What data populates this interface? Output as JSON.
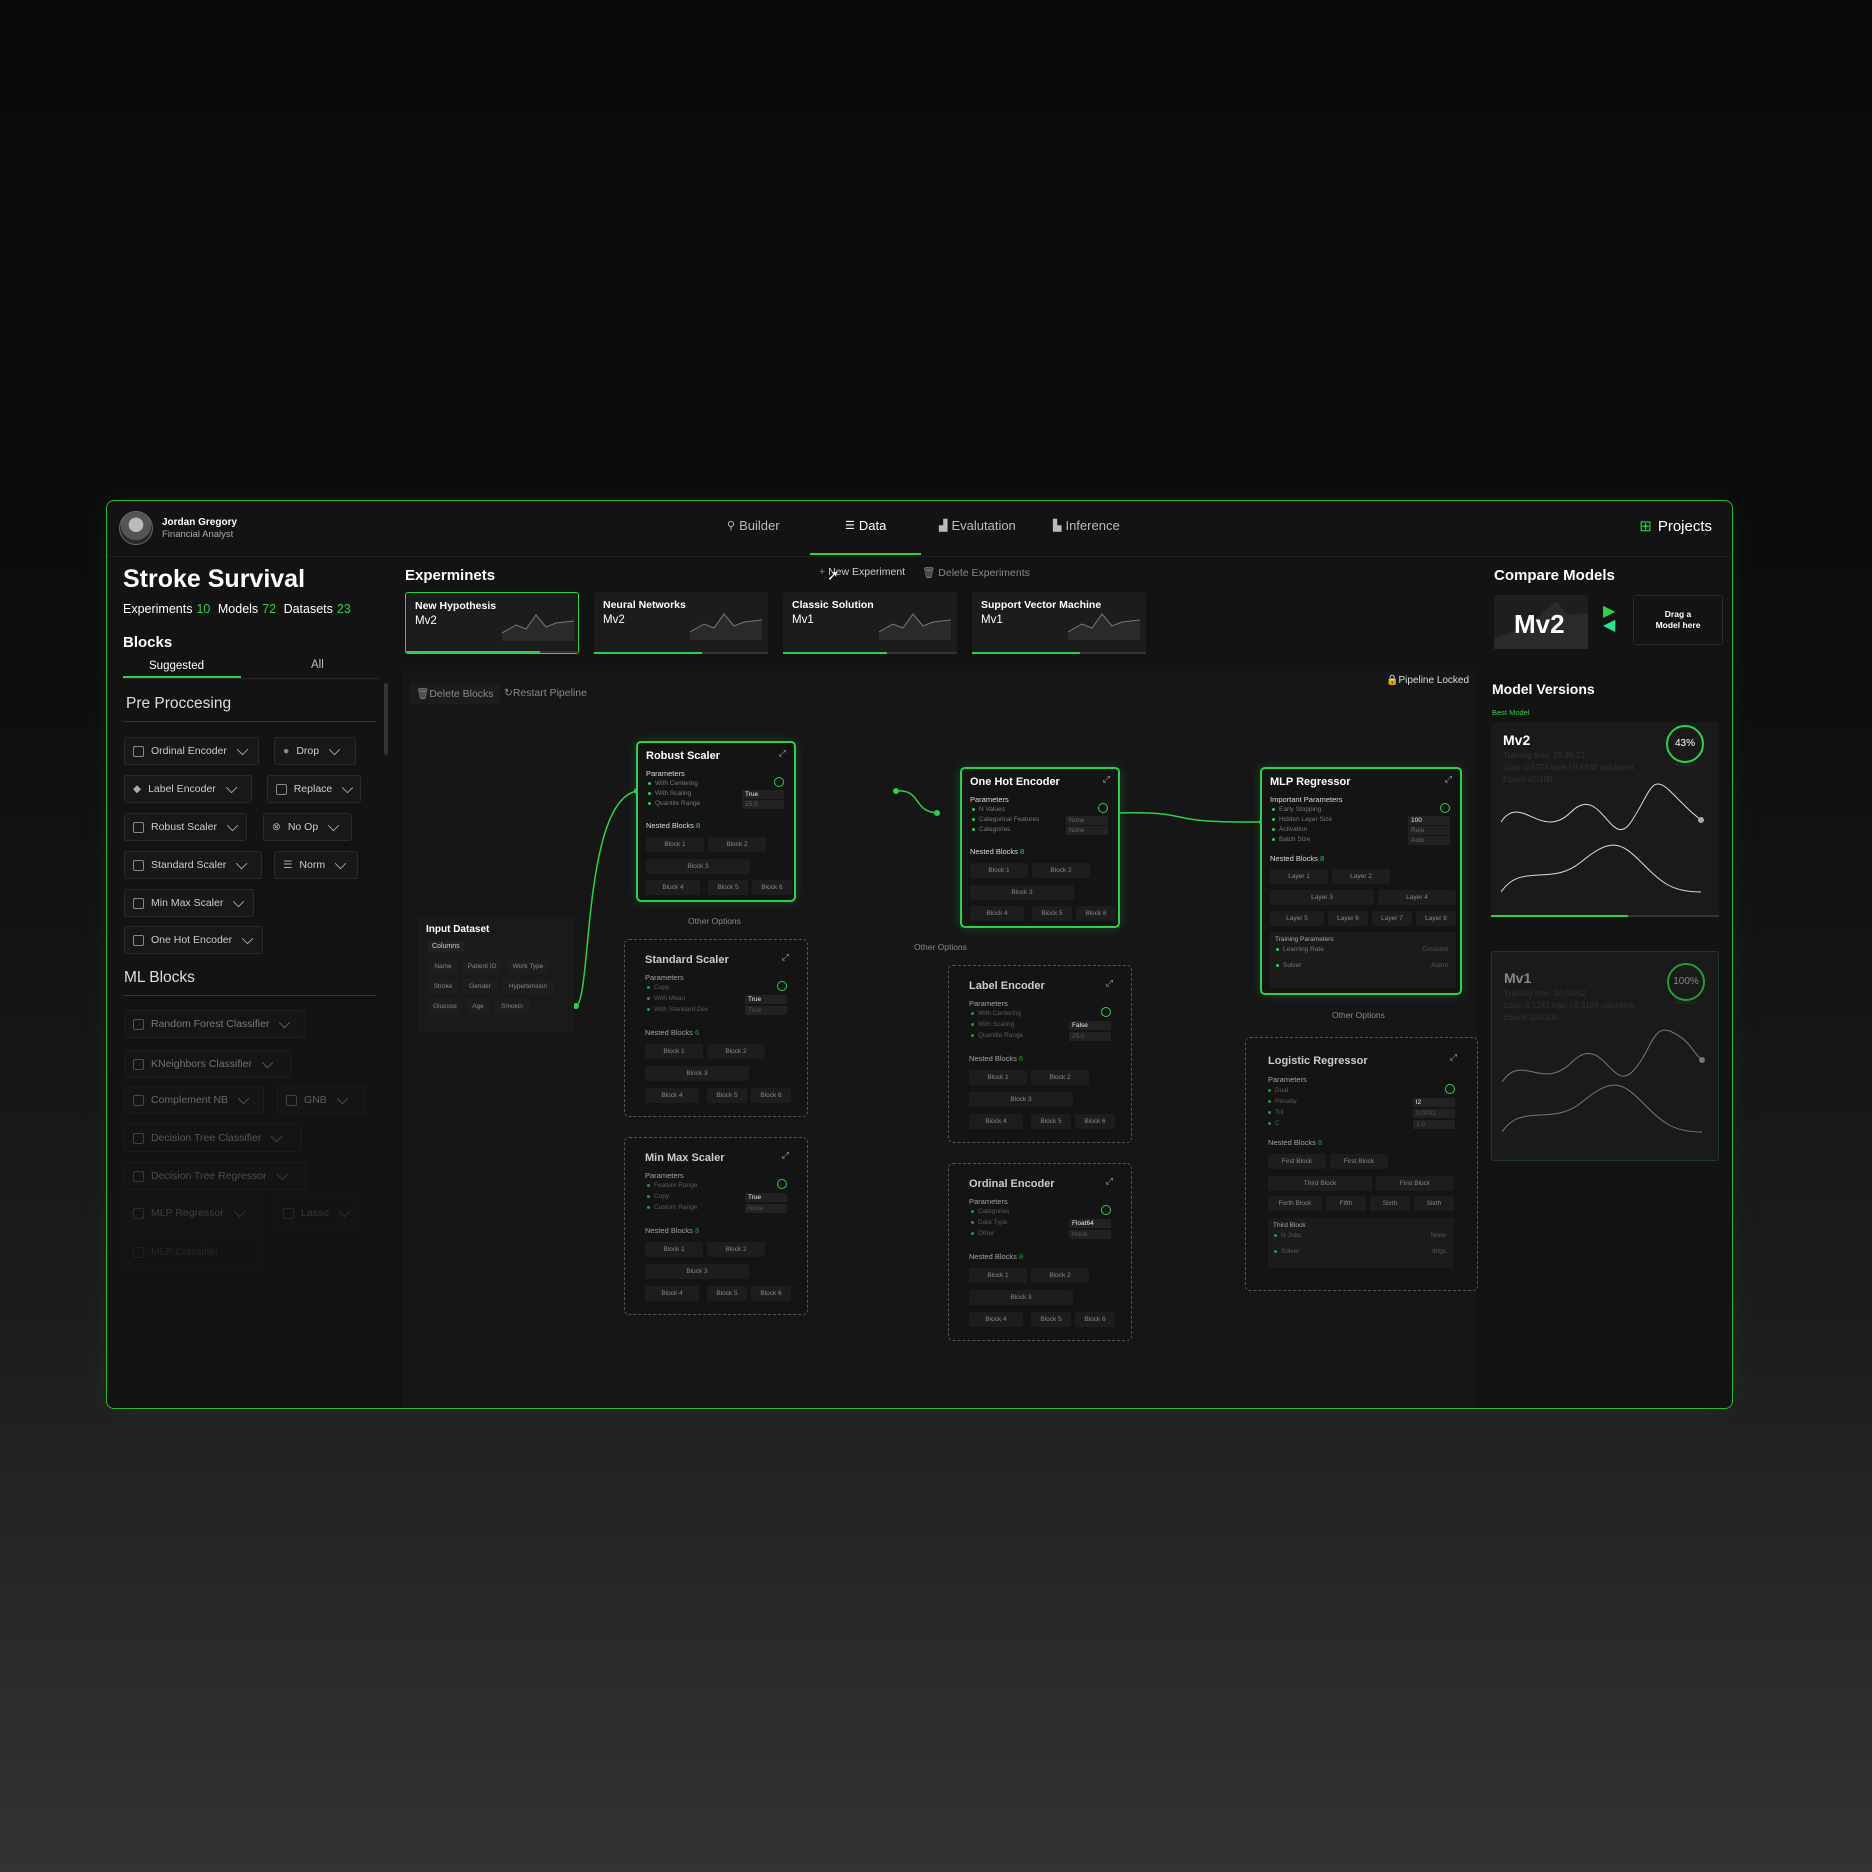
{
  "header": {
    "user_name": "Jordan Gregory",
    "user_role": "Financial Analyst",
    "nav": [
      "Builder",
      "Data",
      "Evalutation",
      "Inference"
    ],
    "active_nav": "Data",
    "projects_label": "Projects"
  },
  "project": {
    "title": "Stroke Survival",
    "experiments_label": "Experiments",
    "experiments_count": "10",
    "models_label": "Models",
    "models_count": "72",
    "datasets_label": "Datasets",
    "datasets_count": "23"
  },
  "blocks": {
    "heading": "Blocks",
    "tabs": [
      "Suggested",
      "All"
    ],
    "active_tab": "Suggested",
    "preprocessing_title": "Pre Proccesing",
    "preprocessing": [
      "Ordinal Encoder",
      "Drop",
      "Label Encoder",
      "Replace",
      "Robust Scaler",
      "No Op",
      "Standard Scaler",
      "Norm",
      "Min Max Scaler",
      "One Hot Encoder"
    ],
    "ml_title": "ML Blocks",
    "ml": [
      "Random Forest Classifier",
      "KNeighbors Classifier",
      "Complement NB",
      "GNB",
      "Decision Tree Classifier",
      "Decision Tree Regressor",
      "MLP Regressor",
      "Lasso",
      "MLP Classifier"
    ]
  },
  "experiments": {
    "heading": "Experminets",
    "new_label": "New Experiment",
    "delete_label": "Delete Experiments",
    "cards": [
      {
        "name": "New Hypothesis",
        "version": "Mv2",
        "progress": 0.78,
        "selected": true
      },
      {
        "name": "Neural Networks",
        "version": "Mv2",
        "progress": 0.62,
        "selected": false
      },
      {
        "name": "Classic Solution",
        "version": "Mv1",
        "progress": 0.6,
        "selected": false
      },
      {
        "name": "Support Vector Machine",
        "version": "Mv1",
        "progress": 0.62,
        "selected": false
      }
    ]
  },
  "pipeline": {
    "delete_blocks": "Delete Blocks",
    "restart": "Restart Pipeline",
    "locked": "Pipeline Locked",
    "other_options": "Other Options",
    "parameters": "Parameters",
    "important_parameters": "Important Parameters",
    "nested_blocks": "Nested Blocks",
    "input": {
      "title": "Input Dataset",
      "columns_label": "Columns",
      "columns": [
        "Name",
        "Patient ID",
        "Work Type",
        "Stroke",
        "Gender",
        "Hypertension",
        "Glucose",
        "Age",
        "Smokin"
      ]
    },
    "robust": {
      "title": "Robust Scaler",
      "params": [
        "With Centering",
        "With Scaling",
        "Quantile Range"
      ],
      "values": [
        "",
        "True",
        "25.0"
      ],
      "nested": "8",
      "blocks": [
        "Block 1",
        "Block 2",
        "Block 3",
        "Block 4",
        "Block 5",
        "Block 6"
      ]
    },
    "onehot": {
      "title": "One Hot Encoder",
      "params": [
        "N Values",
        "Categorical Features",
        "Categories"
      ],
      "values": [
        "",
        "None",
        "None"
      ],
      "nested": "8",
      "blocks": [
        "Block 1",
        "Block 2",
        "Block 3",
        "Block 4",
        "Block 5",
        "Block 6"
      ]
    },
    "mlp": {
      "title": "MLP Regressor",
      "params": [
        "Early Stopping",
        "Hidden Layer Size",
        "Activation",
        "Batch Size"
      ],
      "values": [
        "",
        "100",
        "Relu",
        "Auto"
      ],
      "nested": "8",
      "layers": [
        "Layer 1",
        "Layer 2",
        "Layer 3",
        "Layer 4",
        "Layer 5",
        "Layer 6",
        "Layer 7",
        "Layer 8"
      ],
      "training_label": "Training Parameters",
      "training": [
        "Learning Rate",
        "Solver"
      ],
      "training_values": [
        "Constant",
        "Adam"
      ]
    },
    "standard": {
      "title": "Standard Scaler",
      "params": [
        "Copy",
        "With Mean",
        "With Standard Dev"
      ],
      "values": [
        "",
        "True",
        "True"
      ],
      "nested": "6",
      "blocks": [
        "Block 1",
        "Block 2",
        "Block 3",
        "Block 4",
        "Block 5",
        "Block 6"
      ]
    },
    "label": {
      "title": "Label Encoder",
      "params": [
        "With Centering",
        "With Scaling",
        "Quantile Range"
      ],
      "values": [
        "",
        "False",
        "25.0"
      ],
      "nested": "6",
      "blocks": [
        "Block 1",
        "Block 2",
        "Block 3",
        "Block 4",
        "Block 5",
        "Block 6"
      ]
    },
    "minmax": {
      "title": "Min Max Scaler",
      "params": [
        "Feature Range",
        "Copy",
        "Custom Range"
      ],
      "values": [
        "",
        "True",
        "None"
      ],
      "nested": "8",
      "blocks": [
        "Block 1",
        "Block 2",
        "Block 3",
        "Block 4",
        "Block 5",
        "Block 6"
      ]
    },
    "ordinal": {
      "title": "Ordinal Encoder",
      "params": [
        "Categories",
        "Data Type",
        "Other"
      ],
      "values": [
        "",
        "Float64",
        "None"
      ],
      "nested": "8",
      "blocks": [
        "Block 1",
        "Block 2",
        "Block 3",
        "Block 4",
        "Block 5",
        "Block 6"
      ]
    },
    "logistic": {
      "title": "Logistic Regressor",
      "params": [
        "Dual",
        "Penalty",
        "Tol",
        "C"
      ],
      "values": [
        "",
        "l2",
        "0.0001",
        "1.0"
      ],
      "nested": "8",
      "blocks": [
        "First Block",
        "First Block",
        "Third Block",
        "First Block",
        "Forth Block",
        "Fifth",
        "Sixth",
        "Sixth"
      ],
      "sub_label": "Third Block",
      "sub": [
        "N Jobs",
        "Solver"
      ],
      "sub_values": [
        "None",
        "lbfgs"
      ]
    }
  },
  "compare": {
    "heading": "Compare Models",
    "model": "Mv2",
    "drop_label_1": "Drag a",
    "drop_label_2": "Model here"
  },
  "versions": {
    "heading": "Model Versions",
    "best_label": "Best Model",
    "cards": [
      {
        "name": "Mv2",
        "percent": "43%",
        "percent_label": "Accuracy",
        "time": "Training time: 05:39:23",
        "loss": "Loss: 0.5754 train | 0.6532 validation",
        "epoch": "Epoch 45/100",
        "progress": 0.6
      },
      {
        "name": "Mv1",
        "percent": "100%",
        "percent_label": "Accuracy",
        "time": "Training time: 10:50:52",
        "loss": "Loss: 0.1243 train | 0.3164 validation",
        "epoch": "Epoch 100/100",
        "progress": 1.0
      }
    ]
  },
  "colors": {
    "accent": "#2ed04a",
    "accent_alt": "#2de08a",
    "panel": "#131313"
  }
}
